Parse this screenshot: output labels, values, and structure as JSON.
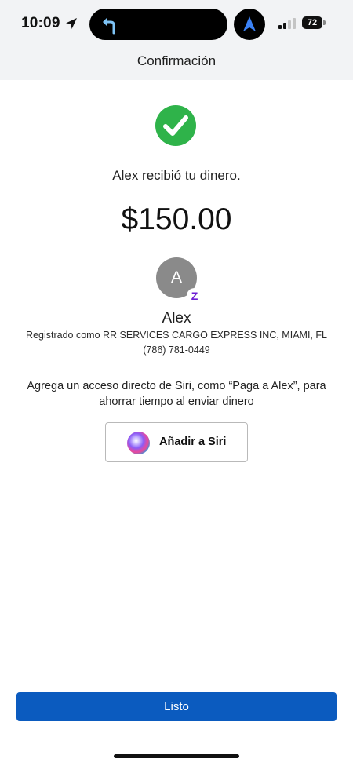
{
  "status_bar": {
    "time": "10:09",
    "battery": "72",
    "icons": [
      "location-arrow-icon",
      "navigation-turn-icon",
      "navigation-icon",
      "signal-icon",
      "battery-icon"
    ]
  },
  "header": {
    "title": "Confirmación"
  },
  "confirmation": {
    "message": "Alex recibió tu dinero.",
    "amount": "$150.00",
    "icon": "check-circle-icon",
    "accent_color": "#2fb34a"
  },
  "recipient": {
    "initial": "A",
    "badge": "Z",
    "name": "Alex",
    "registered": "Registrado como RR SERVICES CARGO EXPRESS INC, MIAMI, FL",
    "phone": "(786) 781-0449"
  },
  "siri": {
    "description": "Agrega un acceso directo de Siri, como “Paga a Alex”, para ahorrar tiempo al enviar dinero",
    "button_label": "Añadir a Siri"
  },
  "footer": {
    "done_label": "Listo",
    "button_color": "#0b5bbf"
  }
}
